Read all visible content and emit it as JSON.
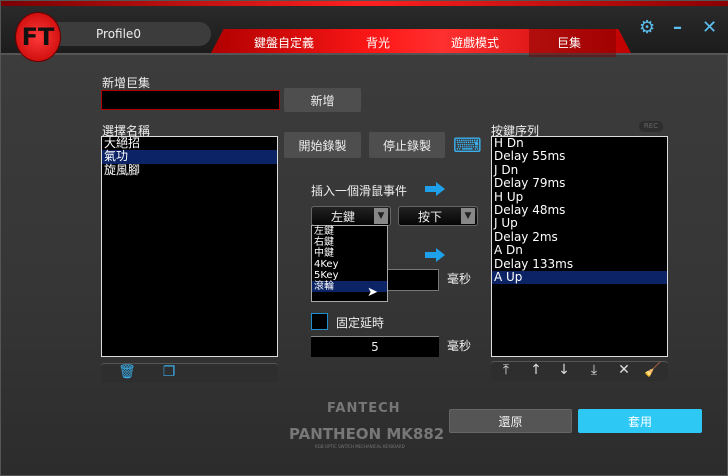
{
  "header": {
    "profile": "Profile0",
    "tabs": [
      "鍵盤自定義",
      "背光",
      "遊戲模式",
      "巨集"
    ],
    "active_tab": "巨集",
    "logo_text": "FT"
  },
  "new_macro": {
    "label": "新增巨集",
    "input_value": "",
    "add_button": "新增"
  },
  "select_name": {
    "label": "選擇名稱",
    "items": [
      "大絕招",
      "氣功",
      "旋風腳"
    ],
    "selected": "氣功"
  },
  "record": {
    "start": "開始錄製",
    "stop": "停止錄製"
  },
  "mouse_event": {
    "label": "插入一個滑鼠事件",
    "button_select": "左鍵",
    "action_select": "按下",
    "options": [
      "左鍵",
      "右鍵",
      "中鍵",
      "4Key",
      "5Key",
      "滾輪"
    ],
    "highlighted_option": "滾輪",
    "delay_value": "",
    "ms_label": "毫秒"
  },
  "fixed_delay": {
    "label": "固定延時",
    "checked": false,
    "value": "5",
    "ms_label": "毫秒"
  },
  "sequence": {
    "label": "按鍵序列",
    "rec_badge": "REC",
    "items": [
      "H Dn",
      "Delay 55ms",
      "J Dn",
      "Delay 79ms",
      "H Up",
      "Delay 48ms",
      "J Up",
      "Delay 2ms",
      "A Dn",
      "Delay 133ms",
      "A Up"
    ],
    "selected": "A Up"
  },
  "brand": {
    "name": "FANTECH",
    "model": "PANTHEON MK882",
    "tagline": "RGB OPTIC SWITCH MECHANICAL KEYBOARD"
  },
  "footer": {
    "restore": "還原",
    "apply": "套用"
  },
  "colors": {
    "accent": "#2ec8f5",
    "brand_red": "#ff1818",
    "selection": "#0c2466"
  }
}
